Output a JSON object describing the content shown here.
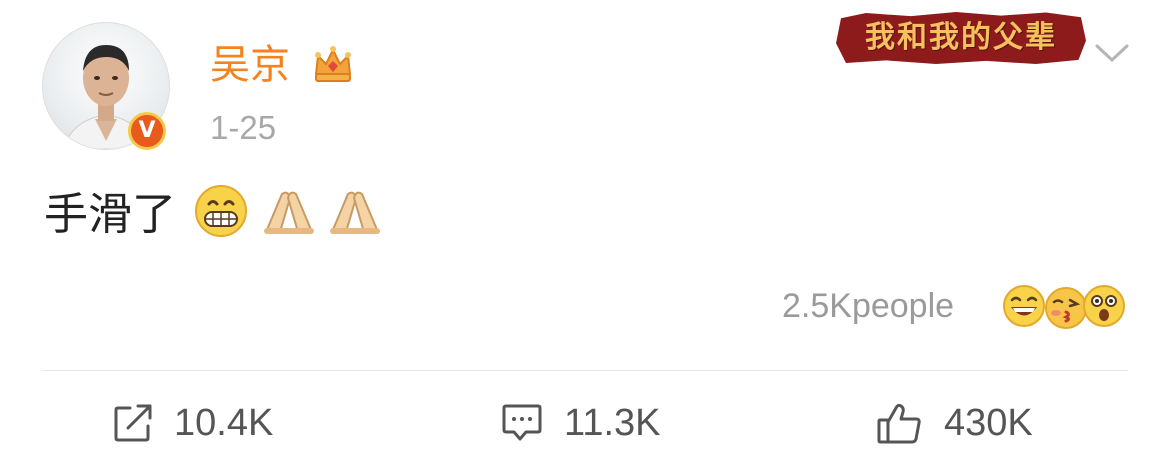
{
  "post": {
    "author": {
      "name": "吴京",
      "verified_badge": "V",
      "membership_icon": "crown-icon"
    },
    "date": "1-25",
    "banner_text": "我和我的父辈",
    "text": "手滑了",
    "inline_emojis": [
      "grinning-face-icon",
      "folded-hands-icon",
      "folded-hands-icon"
    ],
    "reactions": {
      "count_label": "2.5Kpeople",
      "faces": [
        "laughing-face-icon",
        "kissing-face-icon",
        "surprised-face-icon"
      ]
    },
    "actions": {
      "repost_count": "10.4K",
      "comment_count": "11.3K",
      "like_count": "430K"
    },
    "colors": {
      "username": "#f5821f",
      "banner": "#8e1b1b",
      "muted": "#9a9a9a"
    }
  }
}
